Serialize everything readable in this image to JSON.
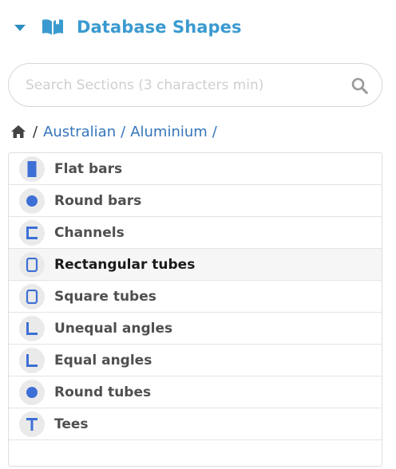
{
  "header": {
    "title": "Database Shapes",
    "caret_icon": "caret-down-icon",
    "book_icon": "open-book-icon",
    "accent": "#3a9ad0"
  },
  "search": {
    "value": "",
    "placeholder": "Search Sections (3 characters min)",
    "icon": "search-icon"
  },
  "breadcrumb": {
    "home_icon": "home-icon",
    "separator": "/",
    "trailing": "/",
    "items": [
      "Australian",
      "Aluminium"
    ]
  },
  "list": {
    "active_index": 3,
    "items": [
      {
        "label": "Flat bars",
        "icon": "flat-bar-icon"
      },
      {
        "label": "Round bars",
        "icon": "round-bar-icon"
      },
      {
        "label": "Channels",
        "icon": "channel-icon"
      },
      {
        "label": "Rectangular tubes",
        "icon": "rectangular-tube-icon"
      },
      {
        "label": "Square tubes",
        "icon": "square-tube-icon"
      },
      {
        "label": "Unequal angles",
        "icon": "unequal-angle-icon"
      },
      {
        "label": "Equal angles",
        "icon": "equal-angle-icon"
      },
      {
        "label": "Round tubes",
        "icon": "round-tube-icon"
      },
      {
        "label": "Tees",
        "icon": "tee-icon"
      }
    ]
  },
  "colors": {
    "icon": "#3d6fd6",
    "link": "#3576bb"
  }
}
